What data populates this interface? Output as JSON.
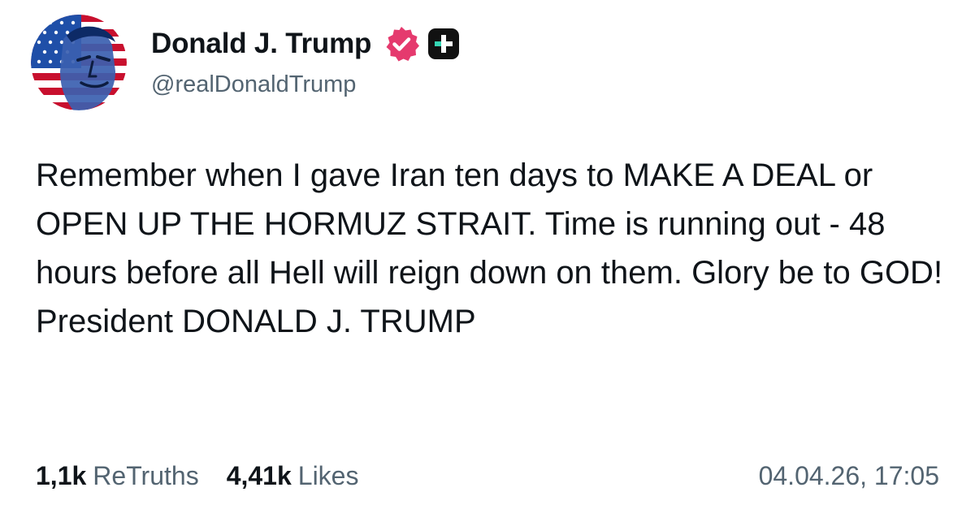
{
  "author": {
    "display_name": "Donald J. Trump",
    "handle": "@realDonaldTrump",
    "avatar_icon": "flag-portrait-avatar",
    "verified_icon": "verified-badge-icon",
    "plus_icon": "plus-badge-icon"
  },
  "post": {
    "text": "Remember when I gave Iran ten days to MAKE A DEAL or OPEN UP THE HORMUZ STRAIT. Time is running out - 48 hours before all Hell will reign down on them. Glory be to GOD! President DONALD J. TRUMP"
  },
  "stats": {
    "retruths_count": "1,1k",
    "retruths_label": "ReTruths",
    "likes_count": "4,41k",
    "likes_label": "Likes"
  },
  "timestamp": "04.04.26, 17:05",
  "colors": {
    "text": "#0f1419",
    "muted": "#536471",
    "verified": "#e53a6e",
    "plus_bg": "#111111",
    "plus_accent": "#35d6b4"
  }
}
